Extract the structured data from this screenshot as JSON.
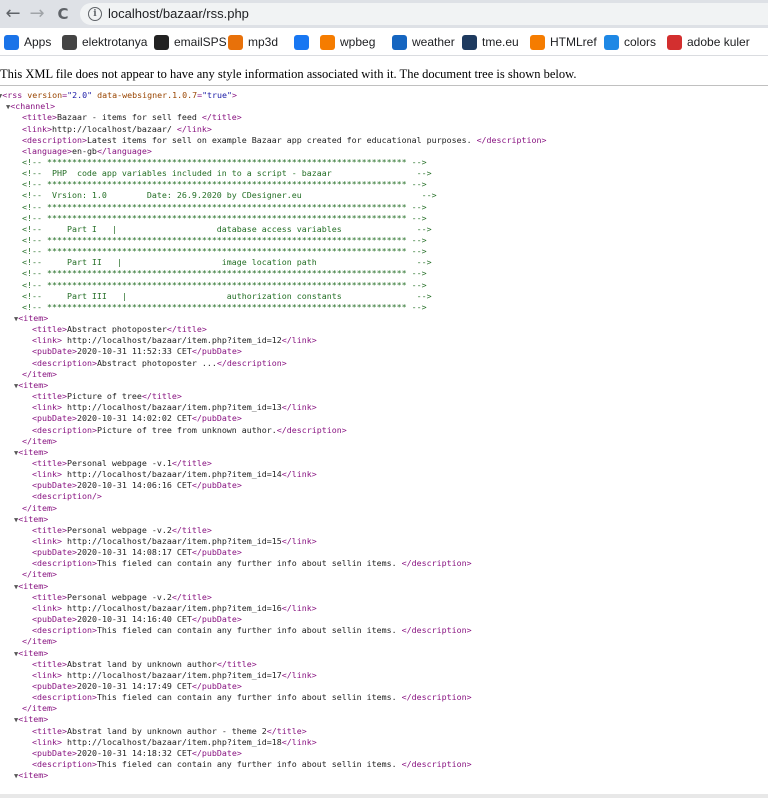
{
  "browser": {
    "url": "localhost/bazaar/rss.php",
    "back_icon": "←",
    "forward_icon": "→",
    "reload_icon": "C",
    "info_icon": "i"
  },
  "bookmarks": [
    {
      "label": "Apps",
      "icon": "apps-grid-icon",
      "color": "#1a73e8"
    },
    {
      "label": "elektrotanya",
      "icon": "elektrotanya-icon",
      "color": "#444444"
    },
    {
      "label": "emailSPS",
      "icon": "emailsps-icon",
      "color": "#222222"
    },
    {
      "label": "mp3d",
      "icon": "mp3d-icon",
      "color": "#e8710a"
    },
    {
      "label": "",
      "icon": "facebook-icon",
      "color": "#1877f2"
    },
    {
      "label": "wpbeg",
      "icon": "wpbeg-icon",
      "color": "#f57c00"
    },
    {
      "label": "weather",
      "icon": "weather-icon",
      "color": "#1565c0"
    },
    {
      "label": "tme.eu",
      "icon": "tme-icon",
      "color": "#1e3a5f"
    },
    {
      "label": "HTMLref",
      "icon": "htmlref-icon",
      "color": "#f57c00"
    },
    {
      "label": "colors",
      "icon": "colors-icon",
      "color": "#1e88e5"
    },
    {
      "label": "adobe kuler",
      "icon": "adobe-icon",
      "color": "#d32f2f"
    }
  ],
  "notice": "This XML file does not appear to have any style information associated with it. The document tree is shown below.",
  "xml": {
    "rss_open": "<rss version=\"2.0\" data-websigner.1.0.7=\"true\">",
    "channel": {
      "title": "Bazaar - items for sell feed ",
      "link": "http://localhost/bazaar/ ",
      "description": "Latest items for sell on example Bazaar app created for educational purposes. ",
      "language": "en-gb"
    },
    "comments": [
      "<!-- ************************************************************************ -->",
      "<!--  PHP  code app variables included in to a script - bazaar                 -->",
      "<!-- ************************************************************************ -->",
      "<!--  Vrsion: 1.0        Date: 26.9.2020 by CDesigner.eu                        -->",
      "<!-- ************************************************************************ -->",
      "<!-- ************************************************************************ -->",
      "<!--     Part I   |                    database access variables               -->",
      "<!-- ************************************************************************ -->",
      "<!-- ************************************************************************ -->",
      "<!--     Part II   |                    image location path                    -->",
      "<!-- ************************************************************************ -->",
      "<!-- ************************************************************************ -->",
      "<!--     Part III   |                    authorization constants               -->",
      "<!-- ************************************************************************ -->"
    ],
    "items": [
      {
        "title": "Abstract photoposter",
        "link": " http://localhost/bazaar/item.php?item_id=12",
        "pubDate": "2020-10-31 11:52:33 CET",
        "description": "Abstract photoposter ..."
      },
      {
        "title": "Picture of tree",
        "link": " http://localhost/bazaar/item.php?item_id=13",
        "pubDate": "2020-10-31 14:02:02 CET",
        "description": "Picture of tree from unknown author."
      },
      {
        "title": "Personal webpage -v.1",
        "link": " http://localhost/bazaar/item.php?item_id=14",
        "pubDate": "2020-10-31 14:06:16 CET",
        "description": null
      },
      {
        "title": "Personal webpage -v.2",
        "link": " http://localhost/bazaar/item.php?item_id=15",
        "pubDate": "2020-10-31 14:08:17 CET",
        "description": "This fieled can contain any further info about sellin items. "
      },
      {
        "title": "Personal webpage -v.2",
        "link": " http://localhost/bazaar/item.php?item_id=16",
        "pubDate": "2020-10-31 14:16:40 CET",
        "description": "This fieled can contain any further info about sellin items. "
      },
      {
        "title": "Abstrat land by unknown author",
        "link": " http://localhost/bazaar/item.php?item_id=17",
        "pubDate": "2020-10-31 14:17:49 CET",
        "description": "This fieled can contain any further info about sellin items. "
      },
      {
        "title": "Abstrat land by unknown author - theme 2",
        "link": " http://localhost/bazaar/item.php?item_id=18",
        "pubDate": "2020-10-31 14:18:32 CET",
        "description": "This fieled can contain any further info about sellin items. "
      }
    ]
  }
}
